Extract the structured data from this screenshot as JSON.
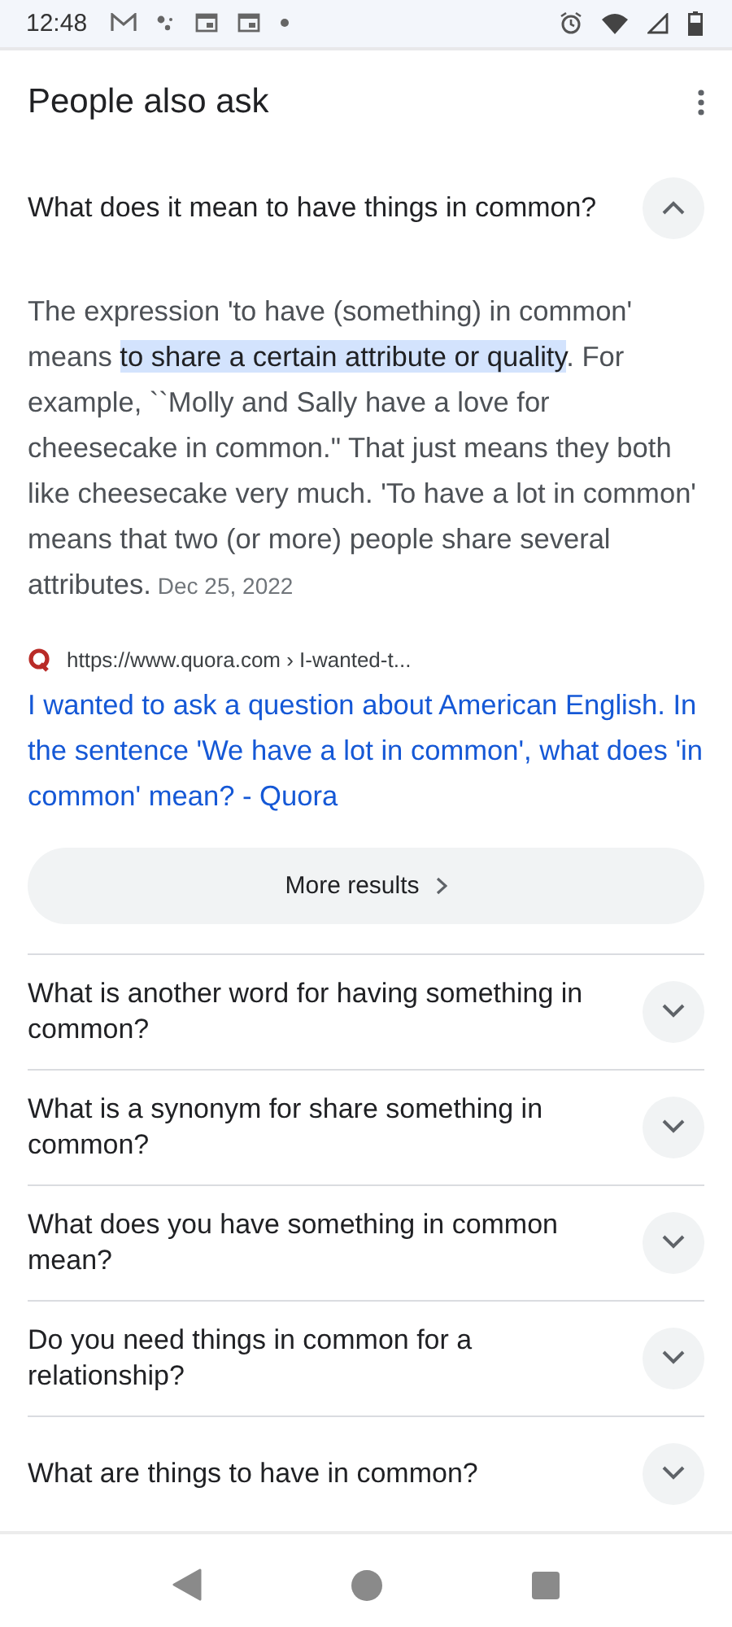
{
  "status_bar": {
    "time": "12:48"
  },
  "section": {
    "title": "People also ask"
  },
  "questions": [
    {
      "text": "What does it mean to have things in common?",
      "expanded": true
    },
    {
      "text": "What is another word for having something in common?",
      "expanded": false
    },
    {
      "text": "What is a synonym for share something in common?",
      "expanded": false
    },
    {
      "text": "What does you have something in common mean?",
      "expanded": false
    },
    {
      "text": "Do you need things in common for a relationship?",
      "expanded": false
    },
    {
      "text": "What are things to have in common?",
      "expanded": false
    }
  ],
  "answer": {
    "before": "The expression 'to have (something) in common' means ",
    "highlight": "to share a certain attribute or quality",
    "after": ". For example, ``Molly and Sally have a love for cheesecake in common.\" That just means they both like cheesecake very much. 'To have a lot in common' means that two (or more) people share several attributes.",
    "date": "Dec 25, 2022",
    "source_url": "https://www.quora.com › I-wanted-t...",
    "link": "I wanted to ask a question about American English. In the sentence 'We have a lot in common', what does 'in common' mean? - Quora"
  },
  "more_results": {
    "label": "More results"
  }
}
